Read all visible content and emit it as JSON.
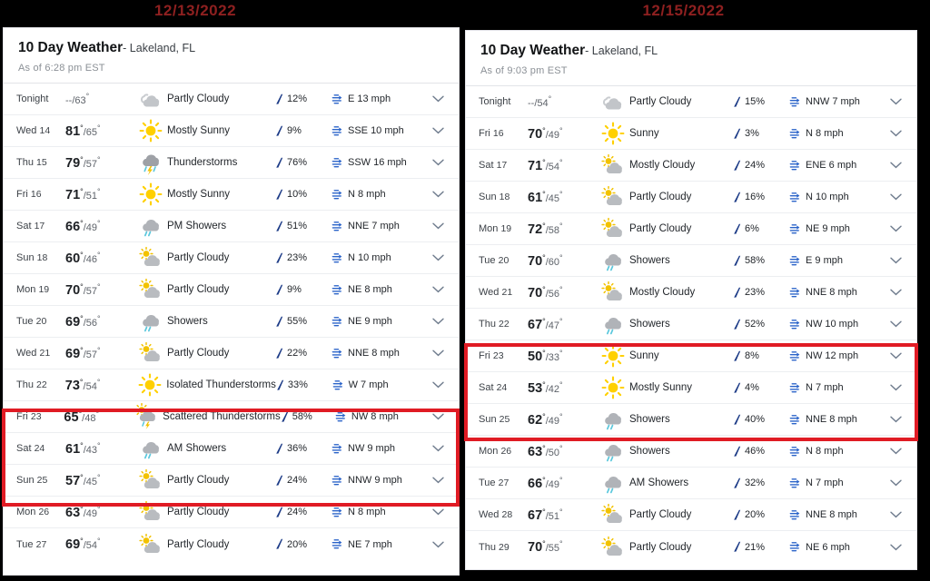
{
  "captions": {
    "left_date": "12/13/2022",
    "right_date": "12/15/2022",
    "highlight_color": "#e01b24",
    "date_color": "#8e2020"
  },
  "left_panel": {
    "title_strong": "10 Day Weather",
    "location": "- Lakeland, FL",
    "as_of": "As of 6:28 pm EST",
    "rows": [
      {
        "day": "Tonight",
        "daynum": "",
        "hi": "--",
        "lo": "63",
        "icon": "night-cloudy-icon",
        "cond": "Partly Cloudy",
        "precip": "12%",
        "wind": "E 13 mph"
      },
      {
        "day": "Wed",
        "daynum": "14",
        "hi": "81",
        "lo": "65",
        "icon": "sun-icon",
        "cond": "Mostly Sunny",
        "precip": "9%",
        "wind": "SSE 10 mph"
      },
      {
        "day": "Thu",
        "daynum": "15",
        "hi": "79",
        "lo": "57",
        "icon": "thunderstorm-icon",
        "cond": "Thunderstorms",
        "precip": "76%",
        "wind": "SSW 16 mph"
      },
      {
        "day": "Fri",
        "daynum": "16",
        "hi": "71",
        "lo": "51",
        "icon": "sun-icon",
        "cond": "Mostly Sunny",
        "precip": "10%",
        "wind": "N 8 mph"
      },
      {
        "day": "Sat",
        "daynum": "17",
        "hi": "66",
        "lo": "49",
        "icon": "showers-icon",
        "cond": "PM Showers",
        "precip": "51%",
        "wind": "NNE 7 mph"
      },
      {
        "day": "Sun",
        "daynum": "18",
        "hi": "60",
        "lo": "46",
        "icon": "sun-cloud-icon",
        "cond": "Partly Cloudy",
        "precip": "23%",
        "wind": "N 10 mph"
      },
      {
        "day": "Mon",
        "daynum": "19",
        "hi": "70",
        "lo": "57",
        "icon": "sun-cloud-icon",
        "cond": "Partly Cloudy",
        "precip": "9%",
        "wind": "NE 8 mph"
      },
      {
        "day": "Tue",
        "daynum": "20",
        "hi": "69",
        "lo": "56",
        "icon": "showers-icon",
        "cond": "Showers",
        "precip": "55%",
        "wind": "NE 9 mph"
      },
      {
        "day": "Wed",
        "daynum": "21",
        "hi": "69",
        "lo": "57",
        "icon": "sun-cloud-icon",
        "cond": "Partly Cloudy",
        "precip": "22%",
        "wind": "NNE 8 mph"
      },
      {
        "day": "Thu",
        "daynum": "22",
        "hi": "73",
        "lo": "54",
        "icon": "sun-icon",
        "cond": "Isolated Thunderstorms",
        "precip": "33%",
        "wind": "W 7 mph"
      },
      {
        "day": "Fri",
        "daynum": "23",
        "hi": "65",
        "lo": "48",
        "icon": "sun-thunderstorm-icon",
        "cond": "Scattered Thunderstorms",
        "precip": "58%",
        "wind": "NW 8 mph"
      },
      {
        "day": "Sat",
        "daynum": "24",
        "hi": "61",
        "lo": "43",
        "icon": "showers-icon",
        "cond": "AM Showers",
        "precip": "36%",
        "wind": "NW 9 mph"
      },
      {
        "day": "Sun",
        "daynum": "25",
        "hi": "57",
        "lo": "45",
        "icon": "sun-cloud-icon",
        "cond": "Partly Cloudy",
        "precip": "24%",
        "wind": "NNW 9 mph"
      },
      {
        "day": "Mon",
        "daynum": "26",
        "hi": "63",
        "lo": "49",
        "icon": "sun-cloud-icon",
        "cond": "Partly Cloudy",
        "precip": "24%",
        "wind": "N 8 mph"
      },
      {
        "day": "Tue",
        "daynum": "27",
        "hi": "69",
        "lo": "54",
        "icon": "sun-cloud-icon",
        "cond": "Partly Cloudy",
        "precip": "20%",
        "wind": "NE 7 mph"
      }
    ],
    "highlight_rows": [
      10,
      11,
      12
    ]
  },
  "right_panel": {
    "title_strong": "10 Day Weather",
    "location": "- Lakeland, FL",
    "as_of": "As of 9:03 pm EST",
    "rows": [
      {
        "day": "Tonight",
        "daynum": "",
        "hi": "--",
        "lo": "54",
        "icon": "night-cloudy-icon",
        "cond": "Partly Cloudy",
        "precip": "15%",
        "wind": "NNW 7 mph"
      },
      {
        "day": "Fri",
        "daynum": "16",
        "hi": "70",
        "lo": "49",
        "icon": "sun-icon",
        "cond": "Sunny",
        "precip": "3%",
        "wind": "N 8 mph"
      },
      {
        "day": "Sat",
        "daynum": "17",
        "hi": "71",
        "lo": "54",
        "icon": "sun-cloud-icon",
        "cond": "Mostly Cloudy",
        "precip": "24%",
        "wind": "ENE 6 mph"
      },
      {
        "day": "Sun",
        "daynum": "18",
        "hi": "61",
        "lo": "45",
        "icon": "sun-cloud-icon",
        "cond": "Partly Cloudy",
        "precip": "16%",
        "wind": "N 10 mph"
      },
      {
        "day": "Mon",
        "daynum": "19",
        "hi": "72",
        "lo": "58",
        "icon": "sun-cloud-icon",
        "cond": "Partly Cloudy",
        "precip": "6%",
        "wind": "NE 9 mph"
      },
      {
        "day": "Tue",
        "daynum": "20",
        "hi": "70",
        "lo": "60",
        "icon": "showers-icon",
        "cond": "Showers",
        "precip": "58%",
        "wind": "E 9 mph"
      },
      {
        "day": "Wed",
        "daynum": "21",
        "hi": "70",
        "lo": "56",
        "icon": "sun-cloud-icon",
        "cond": "Mostly Cloudy",
        "precip": "23%",
        "wind": "NNE 8 mph"
      },
      {
        "day": "Thu",
        "daynum": "22",
        "hi": "67",
        "lo": "47",
        "icon": "showers-icon",
        "cond": "Showers",
        "precip": "52%",
        "wind": "NW 10 mph"
      },
      {
        "day": "Fri",
        "daynum": "23",
        "hi": "50",
        "lo": "33",
        "icon": "sun-icon",
        "cond": "Sunny",
        "precip": "8%",
        "wind": "NW 12 mph"
      },
      {
        "day": "Sat",
        "daynum": "24",
        "hi": "53",
        "lo": "42",
        "icon": "sun-icon",
        "cond": "Mostly Sunny",
        "precip": "4%",
        "wind": "N 7 mph"
      },
      {
        "day": "Sun",
        "daynum": "25",
        "hi": "62",
        "lo": "49",
        "icon": "showers-icon",
        "cond": "Showers",
        "precip": "40%",
        "wind": "NNE 8 mph"
      },
      {
        "day": "Mon",
        "daynum": "26",
        "hi": "63",
        "lo": "50",
        "icon": "showers-icon",
        "cond": "Showers",
        "precip": "46%",
        "wind": "N 8 mph"
      },
      {
        "day": "Tue",
        "daynum": "27",
        "hi": "66",
        "lo": "49",
        "icon": "showers-icon",
        "cond": "AM Showers",
        "precip": "32%",
        "wind": "N 7 mph"
      },
      {
        "day": "Wed",
        "daynum": "28",
        "hi": "67",
        "lo": "51",
        "icon": "sun-cloud-icon",
        "cond": "Partly Cloudy",
        "precip": "20%",
        "wind": "NNE 8 mph"
      },
      {
        "day": "Thu",
        "daynum": "29",
        "hi": "70",
        "lo": "55",
        "icon": "sun-cloud-icon",
        "cond": "Partly Cloudy",
        "precip": "21%",
        "wind": "NE 6 mph"
      }
    ],
    "highlight_rows": [
      8,
      9,
      10
    ]
  }
}
